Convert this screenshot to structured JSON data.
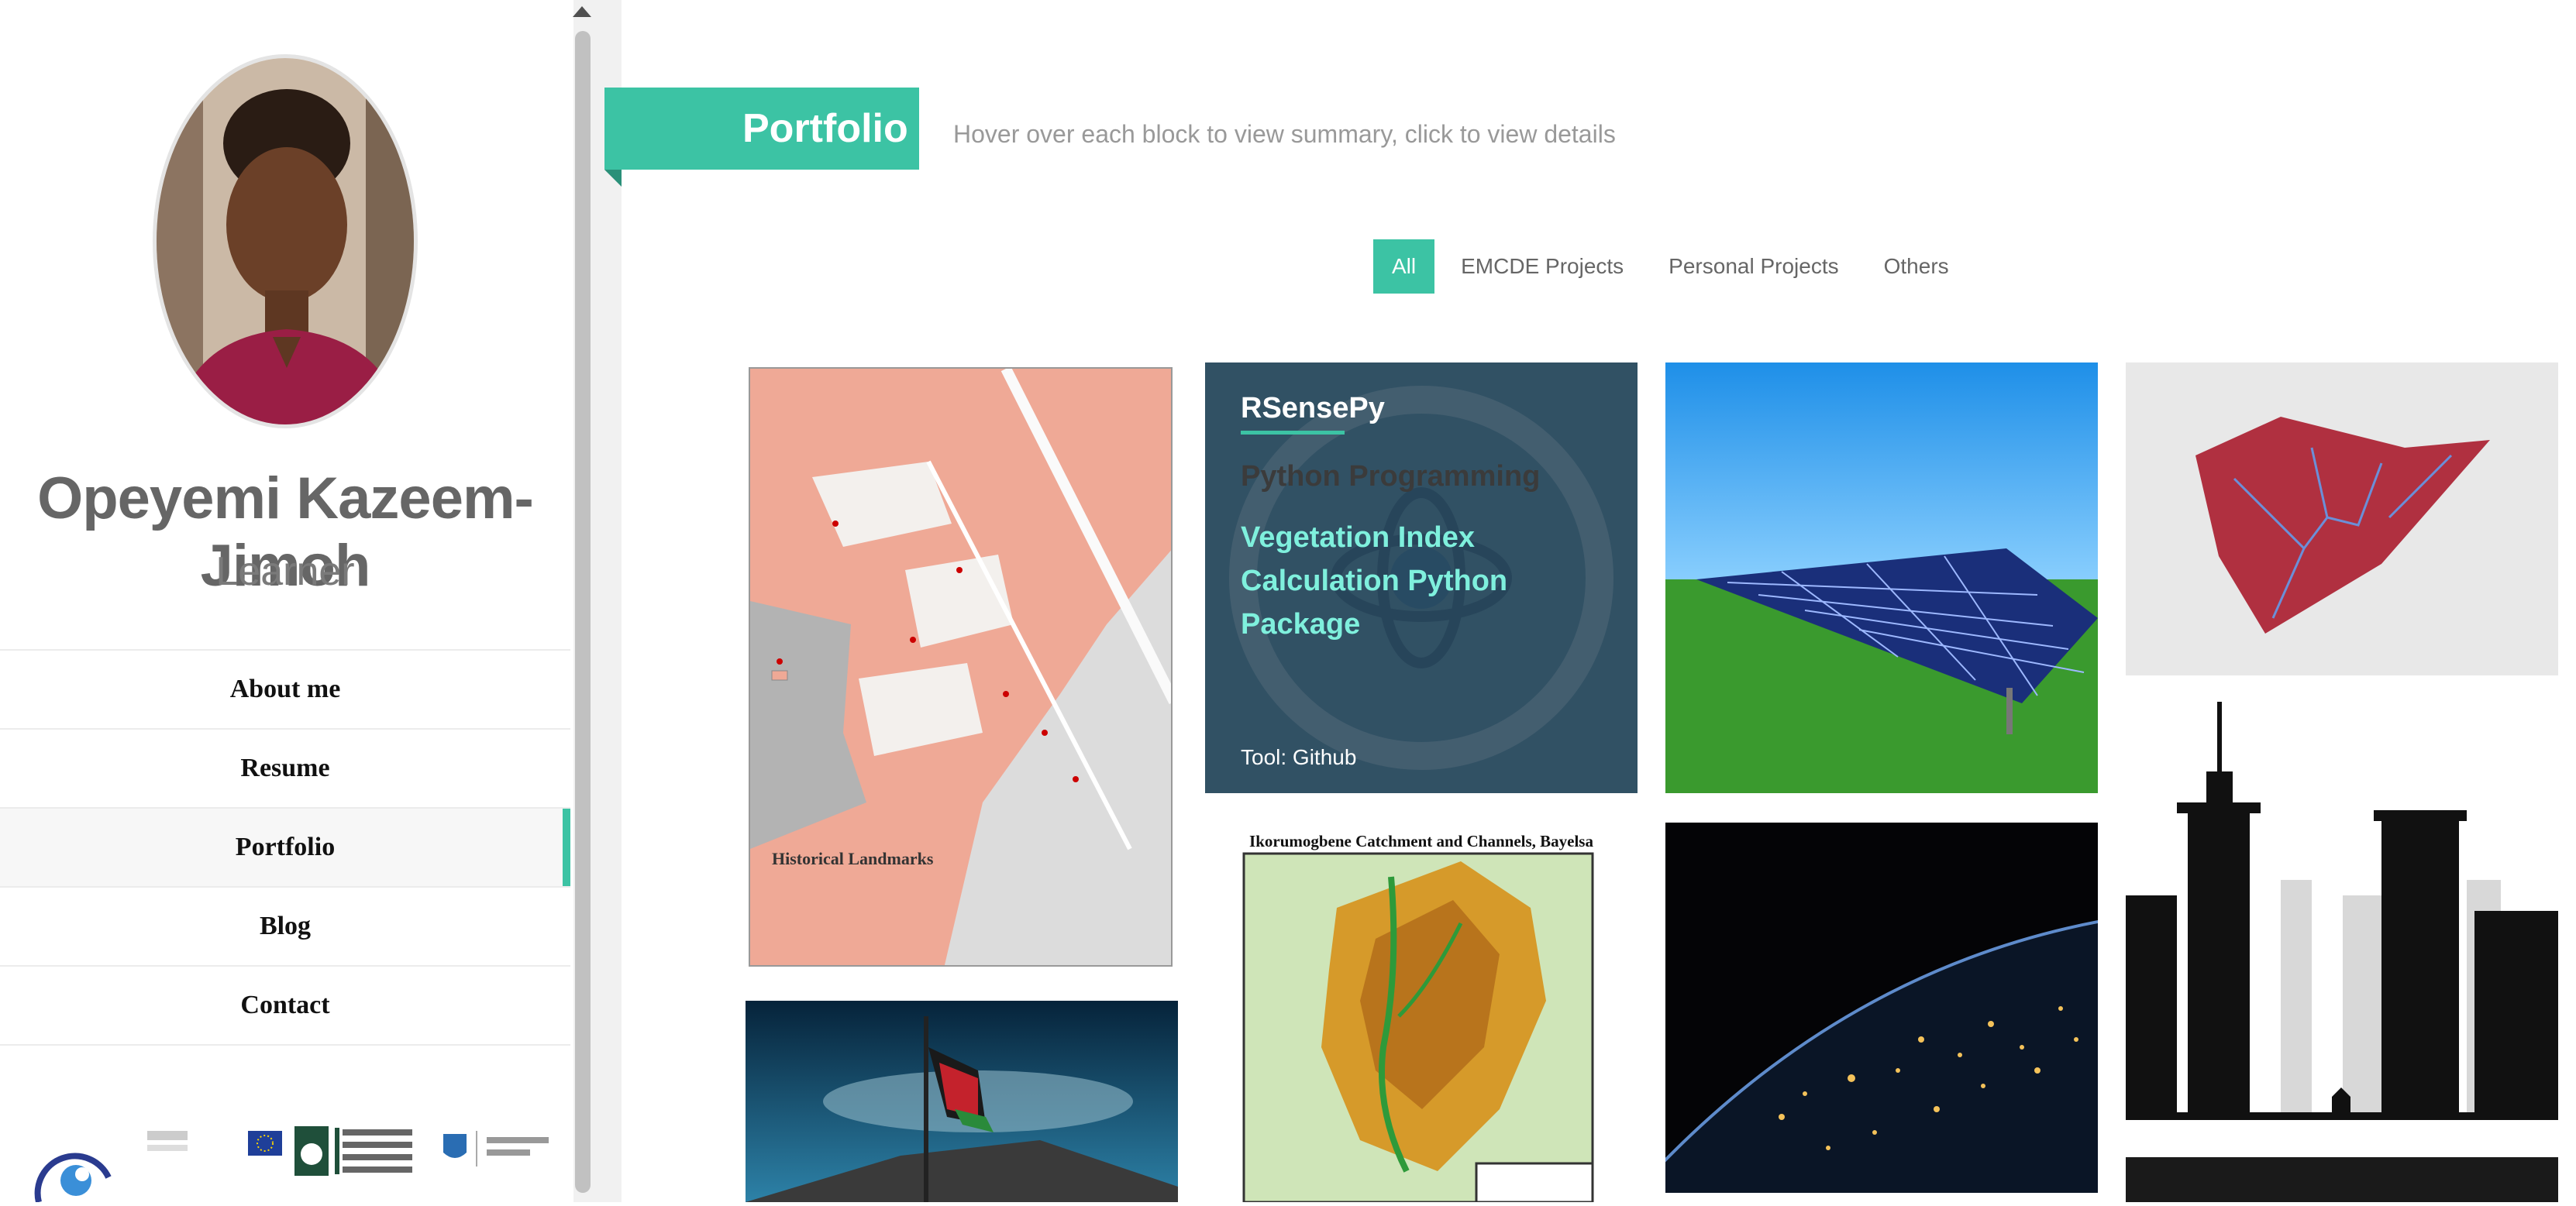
{
  "profile": {
    "name": "Opeyemi Kazeem-Jimoh",
    "role": "Learner"
  },
  "nav": {
    "items": [
      {
        "label": "About me"
      },
      {
        "label": "Resume"
      },
      {
        "label": "Portfolio",
        "active": true
      },
      {
        "label": "Blog"
      },
      {
        "label": "Contact"
      }
    ]
  },
  "portfolio": {
    "title": "Portfolio",
    "subtitle": "Hover over each block to view summary, click to view details",
    "filters": [
      {
        "label": "All",
        "active": true
      },
      {
        "label": "EMCDE Projects"
      },
      {
        "label": "Personal Projects"
      },
      {
        "label": "Others"
      }
    ],
    "rsensepy": {
      "title": "RSensePy",
      "language": "Python Programming",
      "description": "Vegetation Index Calculation Python Package",
      "tool": "Tool: Github"
    },
    "landmarks_map_title": "Historical Landmarks",
    "catchment_map_title": "Ikorumogbene Catchment and Channels, Bayelsa"
  },
  "colors": {
    "accent": "#3cc3a4",
    "sidebar_text": "#666666"
  }
}
